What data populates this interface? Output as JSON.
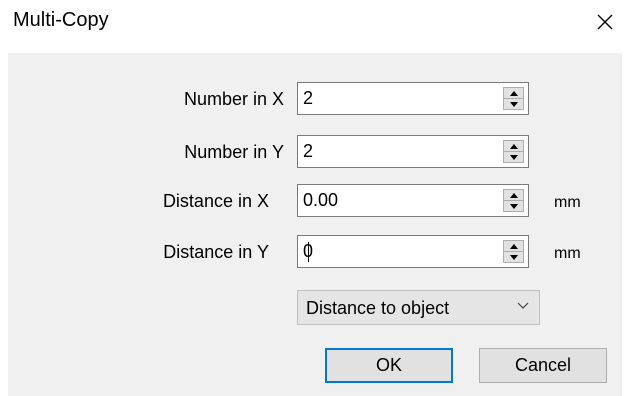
{
  "window": {
    "title": "Multi-Copy",
    "close_icon": "close-icon"
  },
  "form": {
    "number_x": {
      "label": "Number in X",
      "value": "2"
    },
    "number_y": {
      "label": "Number in Y",
      "value": "2"
    },
    "distance_x": {
      "label": "Distance in X",
      "value": "0.00",
      "unit": "mm"
    },
    "distance_y": {
      "label": "Distance in Y",
      "value": "0",
      "unit": "mm"
    },
    "mode_select": {
      "selected": "Distance to object"
    }
  },
  "buttons": {
    "ok": "OK",
    "cancel": "Cancel"
  },
  "colors": {
    "client_bg": "#f0f0f0",
    "accent": "#0078d7"
  }
}
